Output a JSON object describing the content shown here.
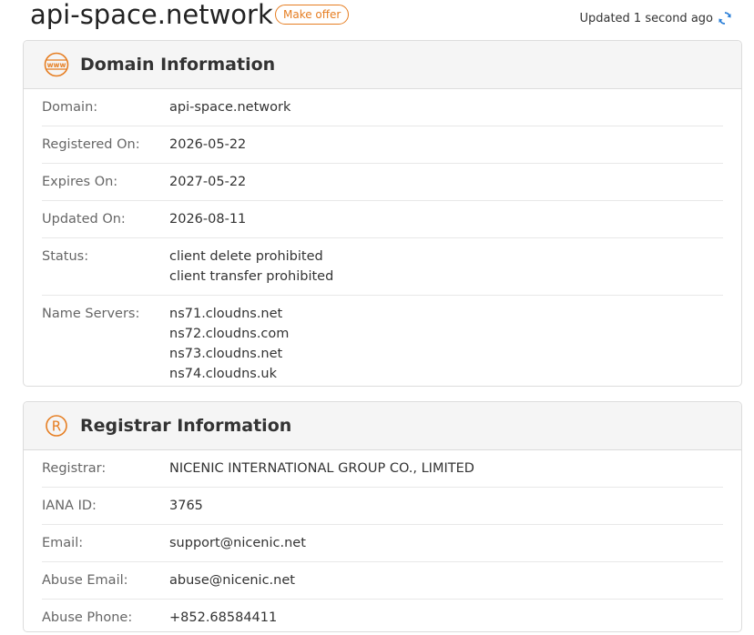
{
  "header": {
    "domain": "api-space.network",
    "offer_label": "Make offer",
    "updated_text": "Updated 1 second ago"
  },
  "domain_info": {
    "title": "Domain Information",
    "icon": "www-icon",
    "domain_label": "Domain:",
    "domain_value": "api-space.network",
    "registered_label": "Registered On:",
    "registered_value": "2026-05-22",
    "expires_label": "Expires On:",
    "expires_value": "2027-05-22",
    "updated_label": "Updated On:",
    "updated_value": "2026-08-11",
    "status_label": "Status:",
    "status_values": [
      "client delete prohibited",
      "client transfer prohibited"
    ],
    "ns_label": "Name Servers:",
    "ns_values": [
      "ns71.cloudns.net",
      "ns72.cloudns.com",
      "ns73.cloudns.net",
      "ns74.cloudns.uk"
    ]
  },
  "registrar_info": {
    "title": "Registrar Information",
    "icon": "registered-icon",
    "registrar_label": "Registrar:",
    "registrar_value": "NICENIC INTERNATIONAL GROUP CO., LIMITED",
    "iana_label": "IANA ID:",
    "iana_value": "3765",
    "email_label": "Email:",
    "email_value": "support@nicenic.net",
    "abuse_email_label": "Abuse Email:",
    "abuse_email_value": "abuse@nicenic.net",
    "abuse_phone_label": "Abuse Phone:",
    "abuse_phone_value": "+852.68584411"
  },
  "colors": {
    "accent": "#e67e22",
    "refresh": "#2b7fd8"
  }
}
